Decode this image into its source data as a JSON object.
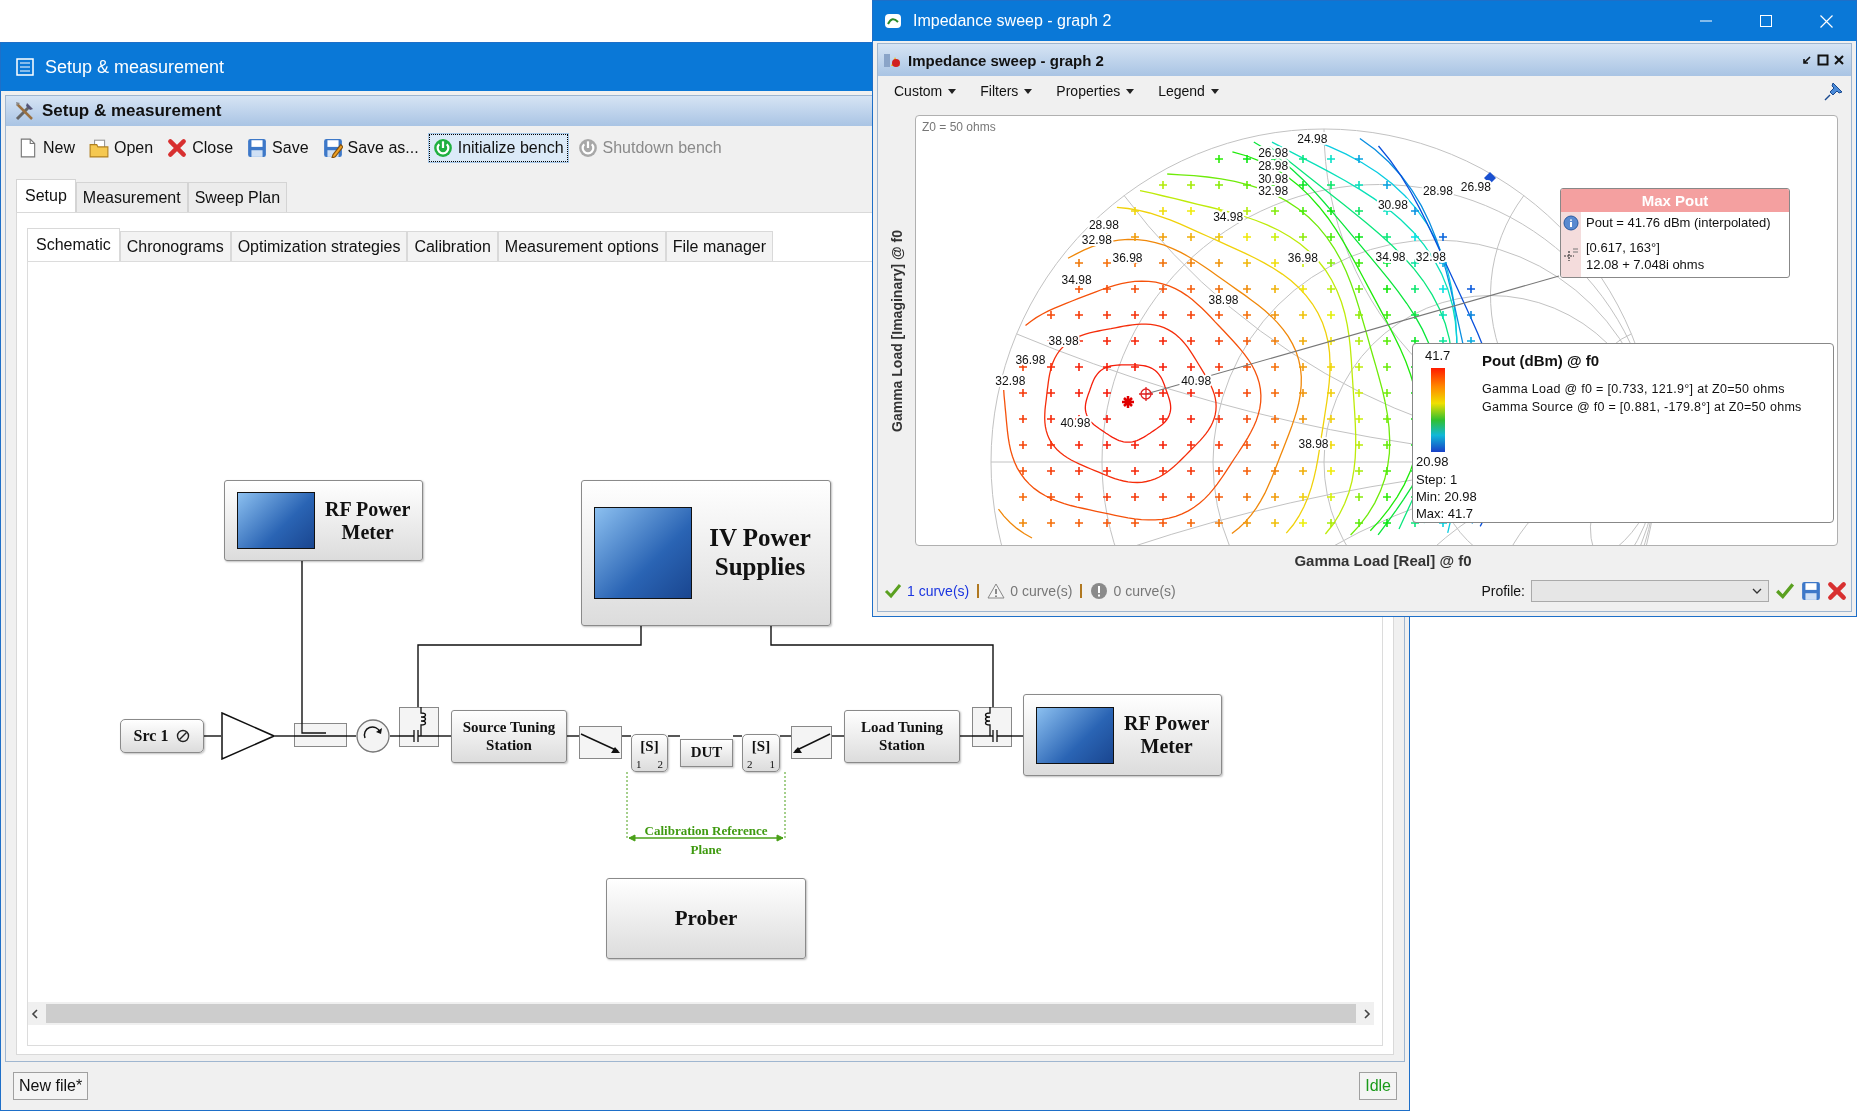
{
  "setup_window": {
    "title": "Setup & measurement",
    "panel_title": "Setup & measurement",
    "toolbar": [
      {
        "kind": "new",
        "label": "New",
        "disabled": false,
        "focused": false
      },
      {
        "kind": "open",
        "label": "Open",
        "disabled": false,
        "focused": false
      },
      {
        "kind": "close",
        "label": "Close",
        "disabled": false,
        "focused": false
      },
      {
        "kind": "save",
        "label": "Save",
        "disabled": false,
        "focused": false
      },
      {
        "kind": "save_as",
        "label": "Save as...",
        "disabled": false,
        "focused": false
      },
      {
        "kind": "initialize",
        "label": "Initialize bench",
        "disabled": false,
        "focused": true
      },
      {
        "kind": "shutdown",
        "label": "Shutdown bench",
        "disabled": true,
        "focused": false
      }
    ],
    "tabs": [
      {
        "label": "Setup",
        "selected": true
      },
      {
        "label": "Measurement",
        "selected": false
      },
      {
        "label": "Sweep Plan",
        "selected": false
      }
    ],
    "subtabs": [
      {
        "label": "Schematic",
        "selected": true
      },
      {
        "label": "Chronograms",
        "selected": false
      },
      {
        "label": "Optimization strategies",
        "selected": false
      },
      {
        "label": "Calibration",
        "selected": false
      },
      {
        "label": "Measurement options",
        "selected": false
      },
      {
        "label": "File manager",
        "selected": false
      }
    ],
    "schematic": {
      "nodes": [
        {
          "kind": "instrument",
          "label": "RF Power\nMeter"
        },
        {
          "kind": "instrument",
          "label": "IV Power\nSupplies"
        },
        {
          "kind": "source",
          "label": "Src 1"
        },
        {
          "kind": "amplifier"
        },
        {
          "kind": "coupler"
        },
        {
          "kind": "circulator"
        },
        {
          "kind": "bias_tee"
        },
        {
          "kind": "station",
          "label": "Source Tuning\nStation"
        },
        {
          "kind": "tuner"
        },
        {
          "kind": "sparam",
          "label": "[S]",
          "ports": [
            "1",
            "2"
          ]
        },
        {
          "kind": "dut",
          "label": "DUT"
        },
        {
          "kind": "sparam",
          "label": "[S]",
          "ports": [
            "2",
            "1"
          ]
        },
        {
          "kind": "tuner"
        },
        {
          "kind": "station",
          "label": "Load Tuning\nStation"
        },
        {
          "kind": "bias_tee"
        },
        {
          "kind": "instrument",
          "label": "RF Power\nMeter"
        },
        {
          "kind": "box",
          "label": "Prober"
        }
      ],
      "reference_plane": "Calibration Reference Plane"
    },
    "status": {
      "file": "New file*",
      "state": "Idle"
    }
  },
  "graph_window": {
    "title": "Impedance sweep - graph 2",
    "panel_title": "Impedance sweep - graph 2",
    "menus": [
      "Custom",
      "Filters",
      "Properties",
      "Legend"
    ],
    "chart": {
      "z0": "Z0 = 50 ohms",
      "ylabel": "Gamma Load [Imaginary] @ f0",
      "xlabel": "Gamma Load [Real] @ f0",
      "contour_labels": [
        "24.98",
        "26.98",
        "28.98",
        "30.98",
        "32.98",
        "28.98",
        "26.98",
        "28.98",
        "32.98",
        "30.98",
        "34.98",
        "36.98",
        "36.98",
        "34.98",
        "32.98",
        "34.98",
        "38.98",
        "38.98",
        "36.98",
        "32.98",
        "40.98",
        "40.98",
        "38.98"
      ],
      "tooltip": {
        "title": "Max Pout",
        "value": "Pout = 41.76 dBm (interpolated)",
        "position": "[0.617, 163°]",
        "impedance": "12.08 + 7.048i ohms"
      },
      "legend": {
        "title": "Pout (dBm) @ f0",
        "max_label": "41.7",
        "min_label": "20.98",
        "step": "Step: 1",
        "min": "Min: 20.98",
        "max": "Max: 41.7",
        "lines": [
          "Gamma Load @ f0 = [0.733, 121.9°] at Z0=50 ohms",
          "Gamma Source @ f0 = [0.881, -179.8°] at Z0=50 ohms"
        ]
      }
    },
    "status": [
      {
        "kind": "ok",
        "label": "1 curve(s)"
      },
      {
        "kind": "warning",
        "label": "0 curve(s)"
      },
      {
        "kind": "error",
        "label": "0 curve(s)"
      }
    ],
    "profile": {
      "label": "Profile:"
    }
  }
}
